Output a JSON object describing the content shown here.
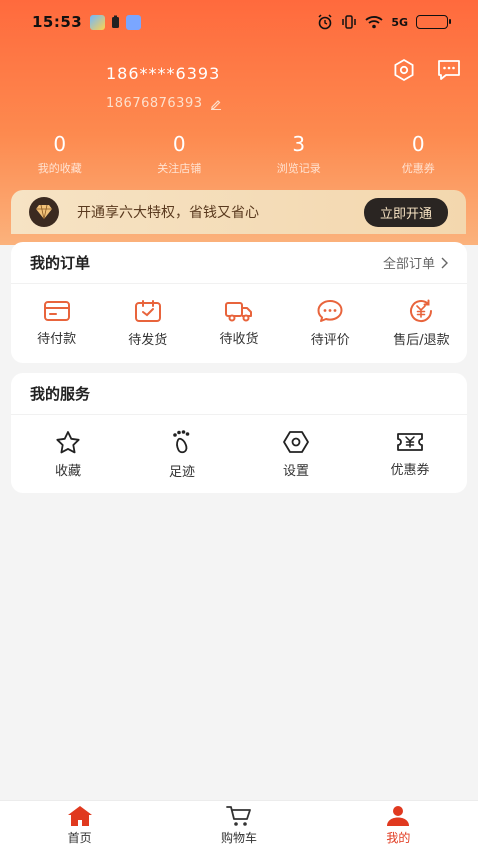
{
  "status_bar": {
    "time": "15:53",
    "network": "5G"
  },
  "user": {
    "masked_phone": "186****6393",
    "account_id": "18676876393"
  },
  "stats": [
    {
      "value": "0",
      "label": "我的收藏"
    },
    {
      "value": "0",
      "label": "关注店铺"
    },
    {
      "value": "3",
      "label": "浏览记录"
    },
    {
      "value": "0",
      "label": "优惠券"
    }
  ],
  "vip": {
    "text": "开通享六大特权，省钱又省心",
    "button": "立即开通"
  },
  "orders": {
    "title": "我的订单",
    "all_link": "全部订单",
    "items": [
      {
        "label": "待付款",
        "icon": "card-icon"
      },
      {
        "label": "待发货",
        "icon": "box-icon"
      },
      {
        "label": "待收货",
        "icon": "truck-icon"
      },
      {
        "label": "待评价",
        "icon": "chat-icon"
      },
      {
        "label": "售后/退款",
        "icon": "refund-icon"
      }
    ]
  },
  "services": {
    "title": "我的服务",
    "items": [
      {
        "label": "收藏",
        "icon": "star-icon"
      },
      {
        "label": "足迹",
        "icon": "footprint-icon"
      },
      {
        "label": "设置",
        "icon": "settings-icon"
      },
      {
        "label": "优惠券",
        "icon": "coupon-icon"
      }
    ]
  },
  "nav": [
    {
      "label": "首页",
      "icon": "home-icon",
      "active": false
    },
    {
      "label": "购物车",
      "icon": "cart-icon",
      "active": false
    },
    {
      "label": "我的",
      "icon": "user-icon",
      "active": true
    }
  ],
  "colors": {
    "accent": "#e0391f",
    "order_icon": "#e8643c",
    "header_top": "#ff6a3d"
  }
}
